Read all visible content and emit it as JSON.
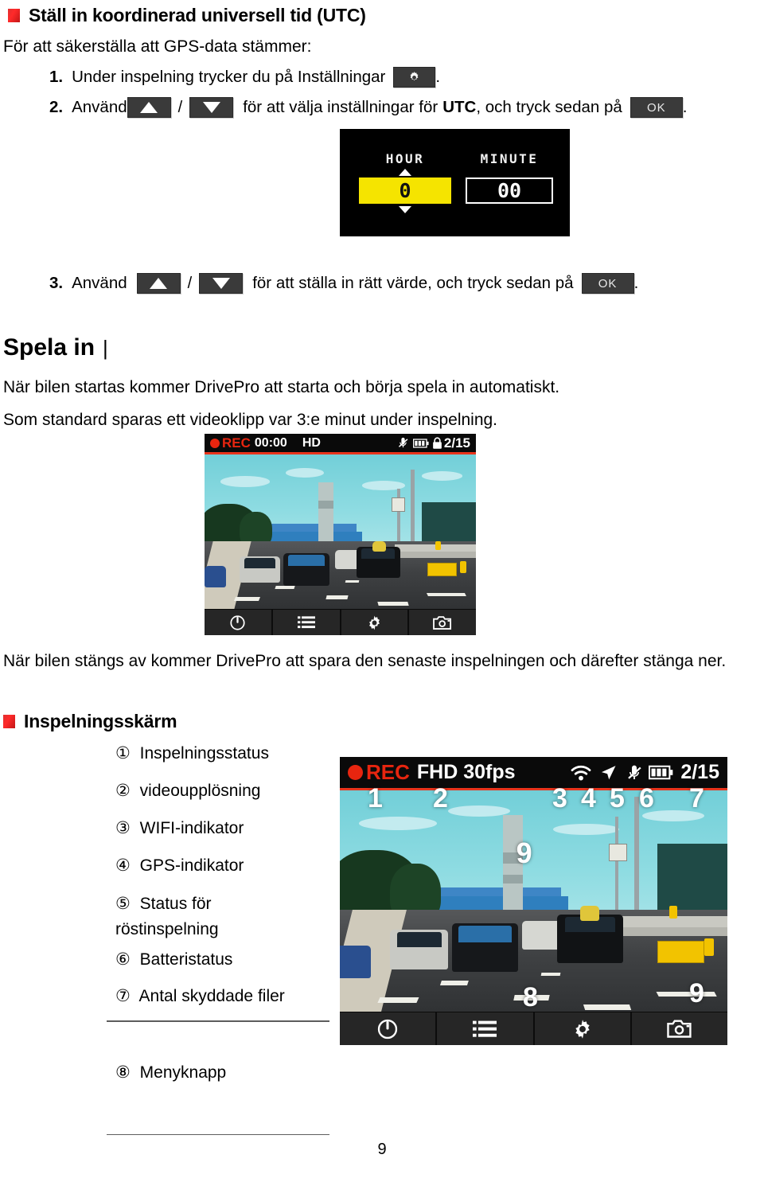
{
  "doc": {
    "page_number": "9"
  },
  "section_utc": {
    "heading": "Ställ in koordinerad universell tid (UTC)",
    "intro": "För att säkerställa att GPS-data stämmer:",
    "steps": [
      {
        "num": "1.",
        "text_before": "Under inspelning trycker du på Inställningar",
        "text_after": ".",
        "icon": "gear-icon"
      },
      {
        "num": "2.",
        "text_before": "Använd",
        "text_middle": "för att välja inställningar för",
        "bold_word": "UTC",
        "text_after": ", och tryck sedan på",
        "text_end": ".",
        "slash": "/",
        "ok_label": "OK"
      },
      {
        "num": "3.",
        "text_before": "Använd",
        "text_middle": "för att ställa in rätt värde, och tryck sedan på",
        "text_end": ".",
        "slash": "/",
        "ok_label": "OK"
      }
    ]
  },
  "utc_screen": {
    "hour_label": "HOUR",
    "hour_value": "0",
    "minute_label": "MINUTE",
    "minute_value": "00",
    "highlight_color": "#f5e400",
    "background_color": "#000000"
  },
  "section_record": {
    "heading": "Spela in",
    "heading_suffix": "|",
    "paragraph_1": "När bilen startas kommer DrivePro att starta och börja spela in automatiskt.",
    "paragraph_2": "Som standard sparas ett videoklipp var 3:e minut under inspelning.",
    "paragraph_3": "När bilen stängs av kommer DrivePro att spara den senaste inspelningen och därefter stänga ner."
  },
  "cam_small": {
    "rec_label": "REC",
    "timer": "00:00",
    "resolution": "HD",
    "protected_files": "2/15",
    "icons": [
      "mic-muted-icon",
      "battery-icon",
      "lock-icon"
    ],
    "toolbar": [
      "power-icon",
      "menu-icon",
      "settings-gear-icon",
      "camera-icon"
    ]
  },
  "cam_large": {
    "rec_label": "REC",
    "resolution": "FHD 30fps",
    "protected_files": "2/15",
    "icons": [
      "wifi-icon",
      "gps-arrow-icon",
      "mic-muted-icon",
      "battery-icon"
    ],
    "toolbar": [
      "power-icon",
      "menu-icon",
      "settings-gear-icon",
      "camera-icon"
    ],
    "callouts": [
      "1",
      "2",
      "3",
      "4",
      "5",
      "6",
      "7",
      "8",
      "9",
      "9"
    ]
  },
  "section_screen": {
    "heading": "Inspelningsskärm",
    "items": [
      {
        "num": "①",
        "label": "Inspelningsstatus"
      },
      {
        "num": "②",
        "label": "videoupplösning"
      },
      {
        "num": "③",
        "label": "WIFI-indikator"
      },
      {
        "num": "④",
        "label": "GPS-indikator"
      },
      {
        "num": "⑤",
        "label": "Status för"
      },
      {
        "num": "",
        "label": "röstinspelning"
      },
      {
        "num": "⑥",
        "label": "Batteristatus"
      },
      {
        "num": "⑦",
        "label": "Antal skyddade filer"
      }
    ],
    "item_menu": {
      "num": "⑧",
      "label": "Menyknapp"
    }
  },
  "colors": {
    "accent_red": "#e8341c",
    "bullet_red": "#ff2a2a",
    "highlight_yellow": "#f5e400"
  }
}
